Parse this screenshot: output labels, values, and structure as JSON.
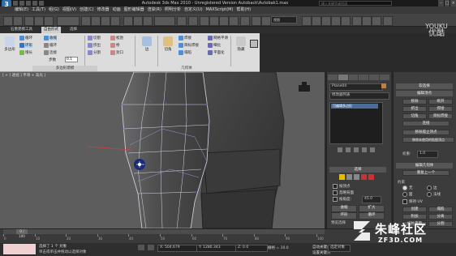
{
  "app": {
    "title": "Autodesk 3ds Max 2010 - Unregistered Version   Autoback\\Autobak1.max",
    "search_placeholder": "键入关键字或短语",
    "logo_letter": "3"
  },
  "menu": [
    "编辑(E)",
    "工具(T)",
    "组(G)",
    "视图(V)",
    "创建(C)",
    "修改器",
    "动画",
    "图形编辑器",
    "渲染(R)",
    "照明分析",
    "自定义(U)",
    "MAXScript(M)",
    "帮助(H)"
  ],
  "toolbar": {
    "view_select": "视图"
  },
  "ribbon": {
    "tabs": [
      {
        "label": "石墨建模工具",
        "active": false
      },
      {
        "label": "自由形式",
        "active": true
      },
      {
        "label": "选择",
        "active": false
      }
    ],
    "sections": [
      "多边形建模",
      "修改选择",
      "编辑",
      "几何体",
      "细分",
      "对齐",
      "属性"
    ],
    "buttons": {
      "polymodel": "多边形",
      "loop": "循环",
      "ring": "环形",
      "grow": "增长",
      "shrink": "收缩",
      "loop2": "循环",
      "conn": "连接",
      "cut": "切割",
      "extrude": "挤出",
      "split": "分割",
      "relax": "松弛",
      "bridge": "桥",
      "cap": "封口",
      "edge": "边",
      "chamfer": "切角",
      "remove": "移除",
      "weld": "焊接",
      "target_weld": "目标焊接",
      "create": "创建",
      "attach": "附加",
      "collapse": "塌陷",
      "meshsmooth": "网格平滑",
      "tessellate": "细化",
      "use_displace": "使用置换",
      "cut_slice": "切片",
      "quickslice": "快速切片",
      "make_planar": "平面化",
      "view_align": "视图对齐",
      "hide": "隐藏",
      "unhide": "全部取消隐藏"
    },
    "step_label": "步数",
    "step_value": "0.1"
  },
  "watermark_youku": {
    "line1": "YOUKU",
    "line2": "优酷"
  },
  "viewport": {
    "label": "[ + ] 透视 ] 平滑 + 高光 ]"
  },
  "cmdpanel": {
    "object_name": "Plane04",
    "modifier_list": "修改器列表",
    "stack_item": "可编辑多边形",
    "selection_header": "选择",
    "by_vertex": "按顶点",
    "ignore_backfacing": "忽略背面",
    "by_angle": "按角度:",
    "angle_value": "45.0",
    "shrink": "收缩",
    "grow": "扩大",
    "ring": "环形",
    "loop": "循环",
    "preview_selection": "预览选择",
    "off": "禁用",
    "subobject": "子对象",
    "multi": "多个",
    "selected_count": "选择了 1 个顶点"
  },
  "rpanel": {
    "soft_selection": "软选择",
    "edit_vertices": "编辑顶点",
    "remove": "移除",
    "break": "断开",
    "extrude": "挤出",
    "weld": "焊接",
    "chamfer": "切角",
    "target_weld": "目标焊接",
    "connect": "连接",
    "remove_isolated": "移除孤立顶点",
    "remove_unused": "移除未使用的贴图顶点",
    "weight": "权重:",
    "weight_value": "1.0",
    "edit_geometry": "编辑几何体",
    "repeat_last": "重复上一个",
    "constraints": "约束",
    "none": "无",
    "edge": "边",
    "face": "面",
    "normal": "法线",
    "preserve_uvs": "保持 UV",
    "create": "创建",
    "collapse": "塌陷",
    "attach": "附加",
    "detach": "分离",
    "slice_plane": "切片平面",
    "split": "分割",
    "slice": "切片",
    "reset_plane": "重置平面",
    "quickslice": "快速切片",
    "cut": "切割"
  },
  "timeline": {
    "frame": "0 / 100",
    "ticks": [
      "0",
      "10",
      "20",
      "30",
      "40",
      "50",
      "60",
      "70",
      "80",
      "90",
      "100"
    ]
  },
  "status": {
    "line1": "选择了 1 个 对象",
    "line2": "单击或单击并拖动以选择对象",
    "x_value": "X: 504.679",
    "y_value": "Y: 1280.343",
    "z_value": "Z: 0.0",
    "grid": "栅格 = 10.0",
    "autokey": "自动关键点",
    "setkey": "设置关键点",
    "selected": "选定对象"
  },
  "watermark_zf3d": {
    "name": "朱峰社区",
    "url": "ZF3D.COM"
  },
  "colors": {
    "ribbon_bg": "#dcdcdc",
    "viewport_bg": "#5d5d5d",
    "selected_vertex": "#1a2b7a",
    "wire": "#d8d8e8",
    "panel_bg": "#3c3c3c",
    "stack_selected": "#4a6d99"
  }
}
